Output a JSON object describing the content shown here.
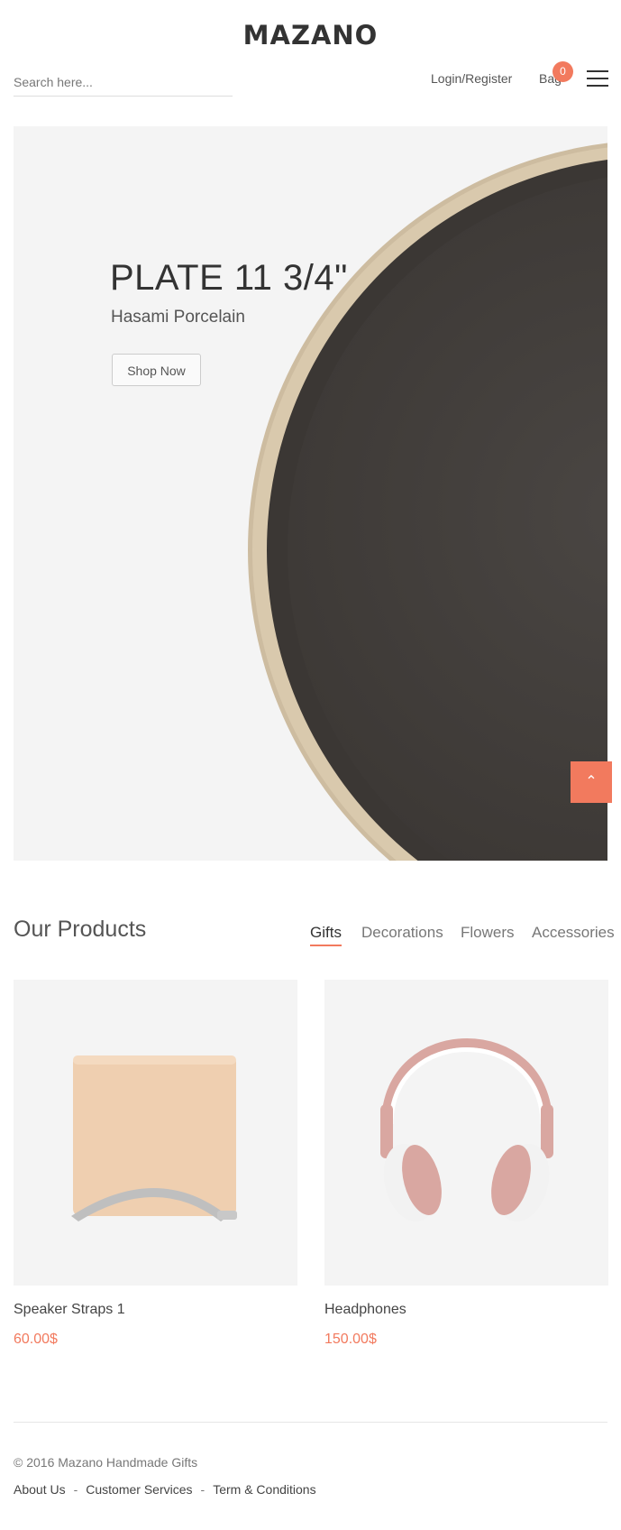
{
  "header": {
    "logo": "MAZANO",
    "search_placeholder": "Search here...",
    "login_label": "Login/Register",
    "bag_label": "Bag",
    "bag_count": "0",
    "menu_icon": "hamburger-menu-icon"
  },
  "hero": {
    "title": "PLATE 11 3/4\"",
    "subtitle": "Hasami Porcelain",
    "button_label": "Shop Now",
    "image": "dark-ceramic-plate"
  },
  "scroll_top": {
    "icon": "chevron-up-icon",
    "glyph": "⌃"
  },
  "products": {
    "title": "Our Products",
    "tabs": [
      {
        "label": "Gifts",
        "active": true
      },
      {
        "label": "Decorations",
        "active": false
      },
      {
        "label": "Flowers",
        "active": false
      },
      {
        "label": "Accessories",
        "active": false
      }
    ],
    "items": [
      {
        "name": "Speaker Straps 1",
        "price": "60.00$",
        "image": "laptop-stand-image"
      },
      {
        "name": "Headphones",
        "price": "150.00$",
        "image": "headphones-image"
      }
    ]
  },
  "footer": {
    "copyright": "© 2016 Mazano Handmade Gifts",
    "links": [
      "About Us",
      "Customer Services",
      "Term & Conditions"
    ],
    "separator": "-"
  },
  "colors": {
    "accent": "#f27a5e",
    "text": "#333333",
    "panel_bg": "#f4f4f4"
  }
}
